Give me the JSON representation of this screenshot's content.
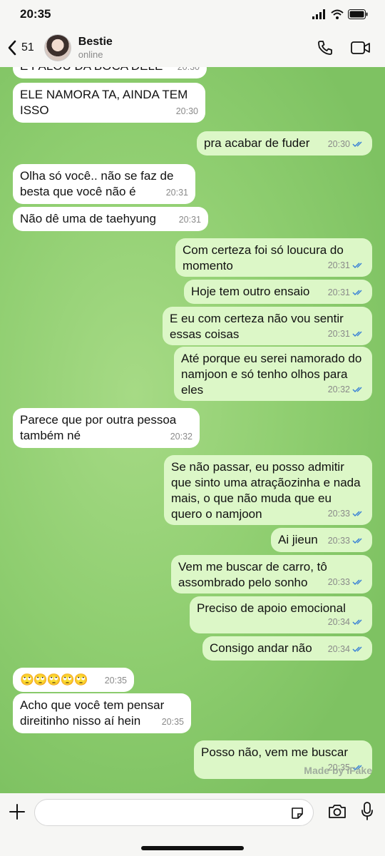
{
  "status_bar": {
    "time": "20:35"
  },
  "header": {
    "back_count": "51",
    "contact_name": "Bestie",
    "contact_status": "online"
  },
  "messages": [
    {
      "dir": "in",
      "text": "E FALOU DA BOCA DELE",
      "time": "20:30"
    },
    {
      "dir": "in",
      "text": "ELE NAMORA TA, AINDA TEM ISSO",
      "time": "20:30"
    },
    {
      "dir": "out",
      "text": "pra acabar de fuder",
      "time": "20:30"
    },
    {
      "dir": "in",
      "text": "Olha só você.. não se faz de besta que você não é",
      "time": "20:31"
    },
    {
      "dir": "in",
      "text": "Não dê uma de taehyung",
      "time": "20:31"
    },
    {
      "dir": "out",
      "text": "Com certeza foi só loucura do momento",
      "time": "20:31"
    },
    {
      "dir": "out",
      "text": "Hoje tem outro ensaio",
      "time": "20:31"
    },
    {
      "dir": "out",
      "text": "E eu com certeza não vou sentir essas coisas",
      "time": "20:31"
    },
    {
      "dir": "out",
      "text": "Até porque eu serei namorado do namjoon e só tenho olhos para eles",
      "time": "20:32"
    },
    {
      "dir": "in",
      "text": "Parece que por outra pessoa também né",
      "time": "20:32"
    },
    {
      "dir": "out",
      "text": "Se não passar, eu posso admitir que sinto uma atraçãozinha e nada mais, o que não muda que eu quero o namjoon",
      "time": "20:33"
    },
    {
      "dir": "out",
      "text": "Ai jieun",
      "time": "20:33"
    },
    {
      "dir": "out",
      "text": "Vem me buscar de carro, tô assombrado pelo sonho",
      "time": "20:33"
    },
    {
      "dir": "out",
      "text": "Preciso de apoio emocional",
      "time": "20:34"
    },
    {
      "dir": "out",
      "text": "Consigo andar não",
      "time": "20:34"
    },
    {
      "dir": "in",
      "text": "🙄🙄🙄🙄🙄",
      "time": "20:35"
    },
    {
      "dir": "in",
      "text": "Acho que você tem pensar direitinho nisso aí hein",
      "time": "20:35"
    },
    {
      "dir": "out",
      "text": "Posso não, vem me buscar",
      "time": "20:35"
    }
  ],
  "watermark": "Made by iFake",
  "icons": {
    "back": "chevron-left-icon",
    "call": "phone-icon",
    "video": "video-icon",
    "attach": "plus-icon",
    "sticker": "sticker-icon",
    "camera": "camera-icon",
    "mic": "microphone-icon",
    "read_receipt": "double-check-icon"
  },
  "colors": {
    "incoming": "#ffffff",
    "outgoing": "#dcf7c7",
    "read_tick": "#3b82d6",
    "wallpaper": "#8fce70"
  }
}
